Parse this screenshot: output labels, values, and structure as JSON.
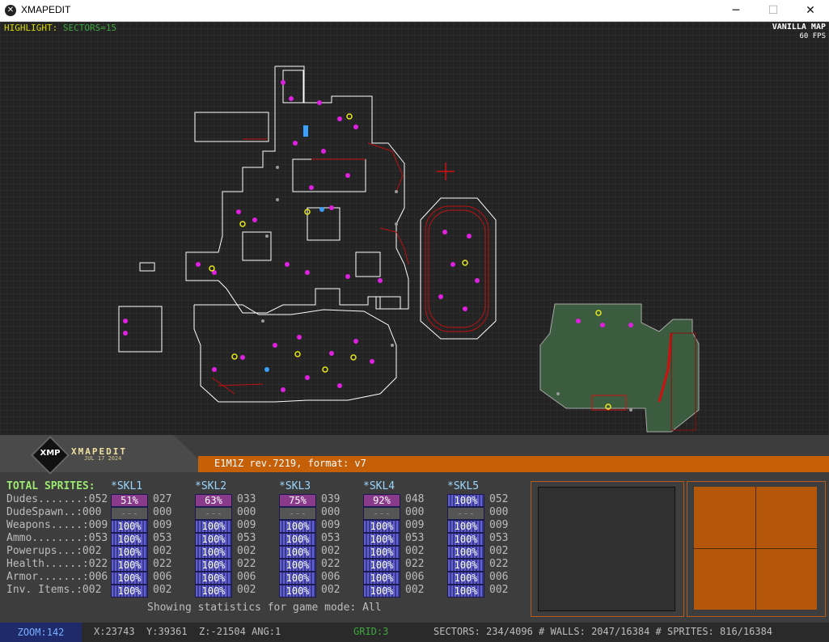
{
  "window": {
    "title": "XMAPEDIT",
    "icon": "x-icon",
    "min": "─",
    "max": "☐",
    "close": "✕"
  },
  "hud": {
    "highlight_label": "HIGHLIGHT:",
    "highlight_value": "SECTORS=15",
    "map_type": "VANILLA MAP",
    "fps": "60 FPS"
  },
  "logo": {
    "badge": "XMP",
    "name": "XMAPEDIT",
    "date": "JUL 17 2024"
  },
  "map_info": "E1M1Z rev.7219, format: v7",
  "stats": {
    "header": "TOTAL SPRITES:",
    "rows": [
      {
        "label": "Dudes.......:052"
      },
      {
        "label": "DudeSpawn..:000"
      },
      {
        "label": "Weapons.....:009"
      },
      {
        "label": "Ammo........:053"
      },
      {
        "label": "Powerups...:002"
      },
      {
        "label": "Health......:022"
      },
      {
        "label": "Armor.......:006"
      },
      {
        "label": "Inv. Items.:002"
      }
    ],
    "skills": [
      {
        "name": "*SKL1",
        "pct": [
          "51%",
          "---",
          "100%",
          "100%",
          "100%",
          "100%",
          "100%",
          "100%"
        ],
        "cnt": [
          "027",
          "000",
          "009",
          "053",
          "002",
          "022",
          "006",
          "002"
        ]
      },
      {
        "name": "*SKL2",
        "pct": [
          "63%",
          "---",
          "100%",
          "100%",
          "100%",
          "100%",
          "100%",
          "100%"
        ],
        "cnt": [
          "033",
          "000",
          "009",
          "053",
          "002",
          "022",
          "006",
          "002"
        ]
      },
      {
        "name": "*SKL3",
        "pct": [
          "75%",
          "---",
          "100%",
          "100%",
          "100%",
          "100%",
          "100%",
          "100%"
        ],
        "cnt": [
          "039",
          "000",
          "009",
          "053",
          "002",
          "022",
          "006",
          "002"
        ]
      },
      {
        "name": "*SKL4",
        "pct": [
          "92%",
          "---",
          "100%",
          "100%",
          "100%",
          "100%",
          "100%",
          "100%"
        ],
        "cnt": [
          "048",
          "000",
          "009",
          "053",
          "002",
          "022",
          "006",
          "002"
        ]
      },
      {
        "name": "*SKL5",
        "pct": [
          "100%",
          "---",
          "100%",
          "100%",
          "100%",
          "100%",
          "100%",
          "100%"
        ],
        "cnt": [
          "052",
          "000",
          "009",
          "053",
          "002",
          "022",
          "006",
          "002"
        ]
      }
    ],
    "footer": "Showing statistics for game mode: All"
  },
  "status": {
    "zoom": "ZOOM:142",
    "coords": "X:23743  Y:39361  Z:-21504 ANG:1",
    "grid": "GRID:3",
    "counts": "SECTORS: 234/4096 # WALLS: 2047/16384 # SPRITES: 816/16384"
  },
  "colors": {
    "accent_orange": "#c55f08",
    "wall": "#ffffff",
    "sprite": "#e020e0",
    "red_wall": "#d01010",
    "sector_green": "#3a5a3a"
  }
}
